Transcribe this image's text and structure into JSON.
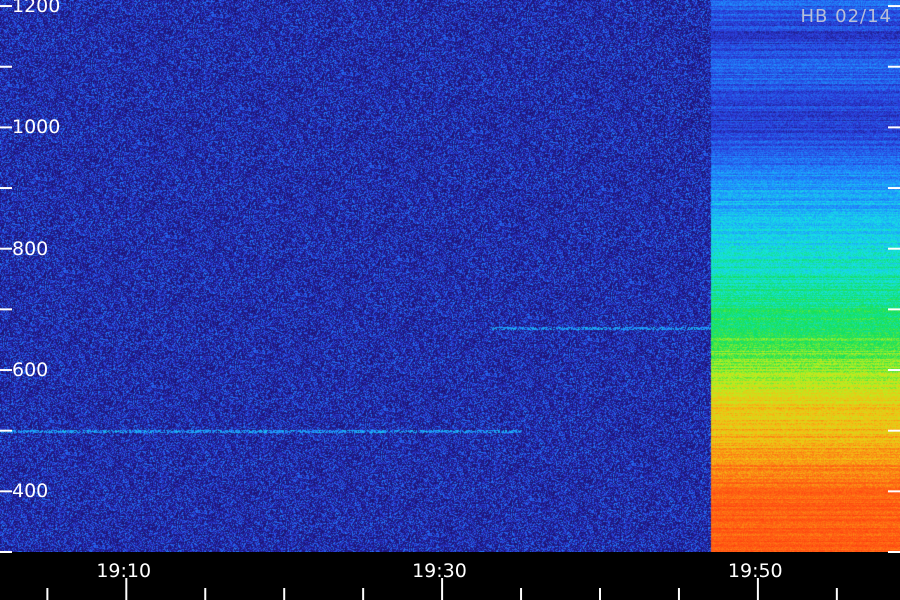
{
  "chart_data": {
    "type": "heatmap",
    "title": "",
    "xlabel": "",
    "ylabel": "",
    "annotation": "HB 02/14",
    "y_ticks": [
      400,
      600,
      800,
      1000,
      1200
    ],
    "y_minor_ticks": [
      300,
      500,
      700,
      900,
      1100
    ],
    "ylim": [
      300,
      1210
    ],
    "x_tick_labels": [
      "19:10",
      "19:30",
      "19:50"
    ],
    "x_range_minutes": [
      "19:02",
      "19:59"
    ],
    "signal_onset": "19:47",
    "colorscale": [
      "#1a0b5e",
      "#2a3bd8",
      "#1f8cff",
      "#16e0e6",
      "#14e05a",
      "#b8f020",
      "#f4c014",
      "#ff6a14",
      "#ff3a10"
    ],
    "features": [
      {
        "kind": "narrow-band line",
        "y": 500,
        "from": "19:02",
        "to": "19:35"
      },
      {
        "kind": "narrow-band line",
        "y": 670,
        "from": "19:33",
        "to": "19:47"
      },
      {
        "kind": "broadband intensity",
        "from": "19:47",
        "to": "19:59",
        "profile": [
          {
            "y": 300,
            "level": 0.92
          },
          {
            "y": 400,
            "level": 0.9
          },
          {
            "y": 460,
            "level": 0.8
          },
          {
            "y": 540,
            "level": 0.72
          },
          {
            "y": 600,
            "level": 0.6
          },
          {
            "y": 700,
            "level": 0.47
          },
          {
            "y": 780,
            "level": 0.4
          },
          {
            "y": 850,
            "level": 0.32
          },
          {
            "y": 900,
            "level": 0.28
          },
          {
            "y": 950,
            "level": 0.2
          },
          {
            "y": 1000,
            "level": 0.12
          },
          {
            "y": 1050,
            "level": 0.15
          },
          {
            "y": 1100,
            "level": 0.2
          },
          {
            "y": 1150,
            "level": 0.12
          },
          {
            "y": 1210,
            "level": 0.2
          }
        ]
      }
    ]
  }
}
